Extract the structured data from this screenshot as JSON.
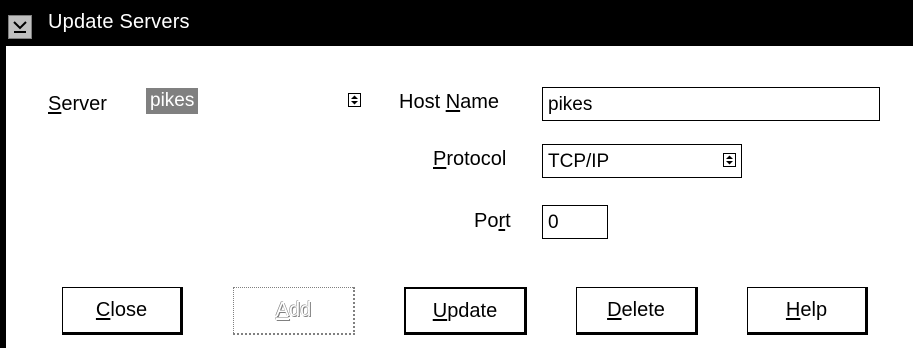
{
  "window": {
    "title": "Update Servers"
  },
  "form": {
    "server": {
      "label_pre": "",
      "label_ul": "S",
      "label_post": "erver",
      "value": "pikes"
    },
    "host_name": {
      "label_pre": "Host ",
      "label_ul": "N",
      "label_post": "ame",
      "value": "pikes"
    },
    "protocol": {
      "label_pre": "",
      "label_ul": "P",
      "label_post": "rotocol",
      "value": "TCP/IP"
    },
    "port": {
      "label_pre": "Po",
      "label_ul": "r",
      "label_post": "t",
      "value": "0"
    }
  },
  "buttons": {
    "close": {
      "ul": "C",
      "rest": "lose"
    },
    "add": {
      "ul": "A",
      "rest": "dd",
      "disabled": true
    },
    "update": {
      "ul": "U",
      "rest": "pdate",
      "default": true
    },
    "delete": {
      "ul": "D",
      "rest": "elete"
    },
    "help": {
      "ul": "H",
      "rest": "elp"
    }
  },
  "icons": {
    "system_menu": "system-menu-icon",
    "dropdown": "spin-arrows-icon"
  },
  "colors": {
    "titlebar": "#000000",
    "selection": "#808080"
  }
}
